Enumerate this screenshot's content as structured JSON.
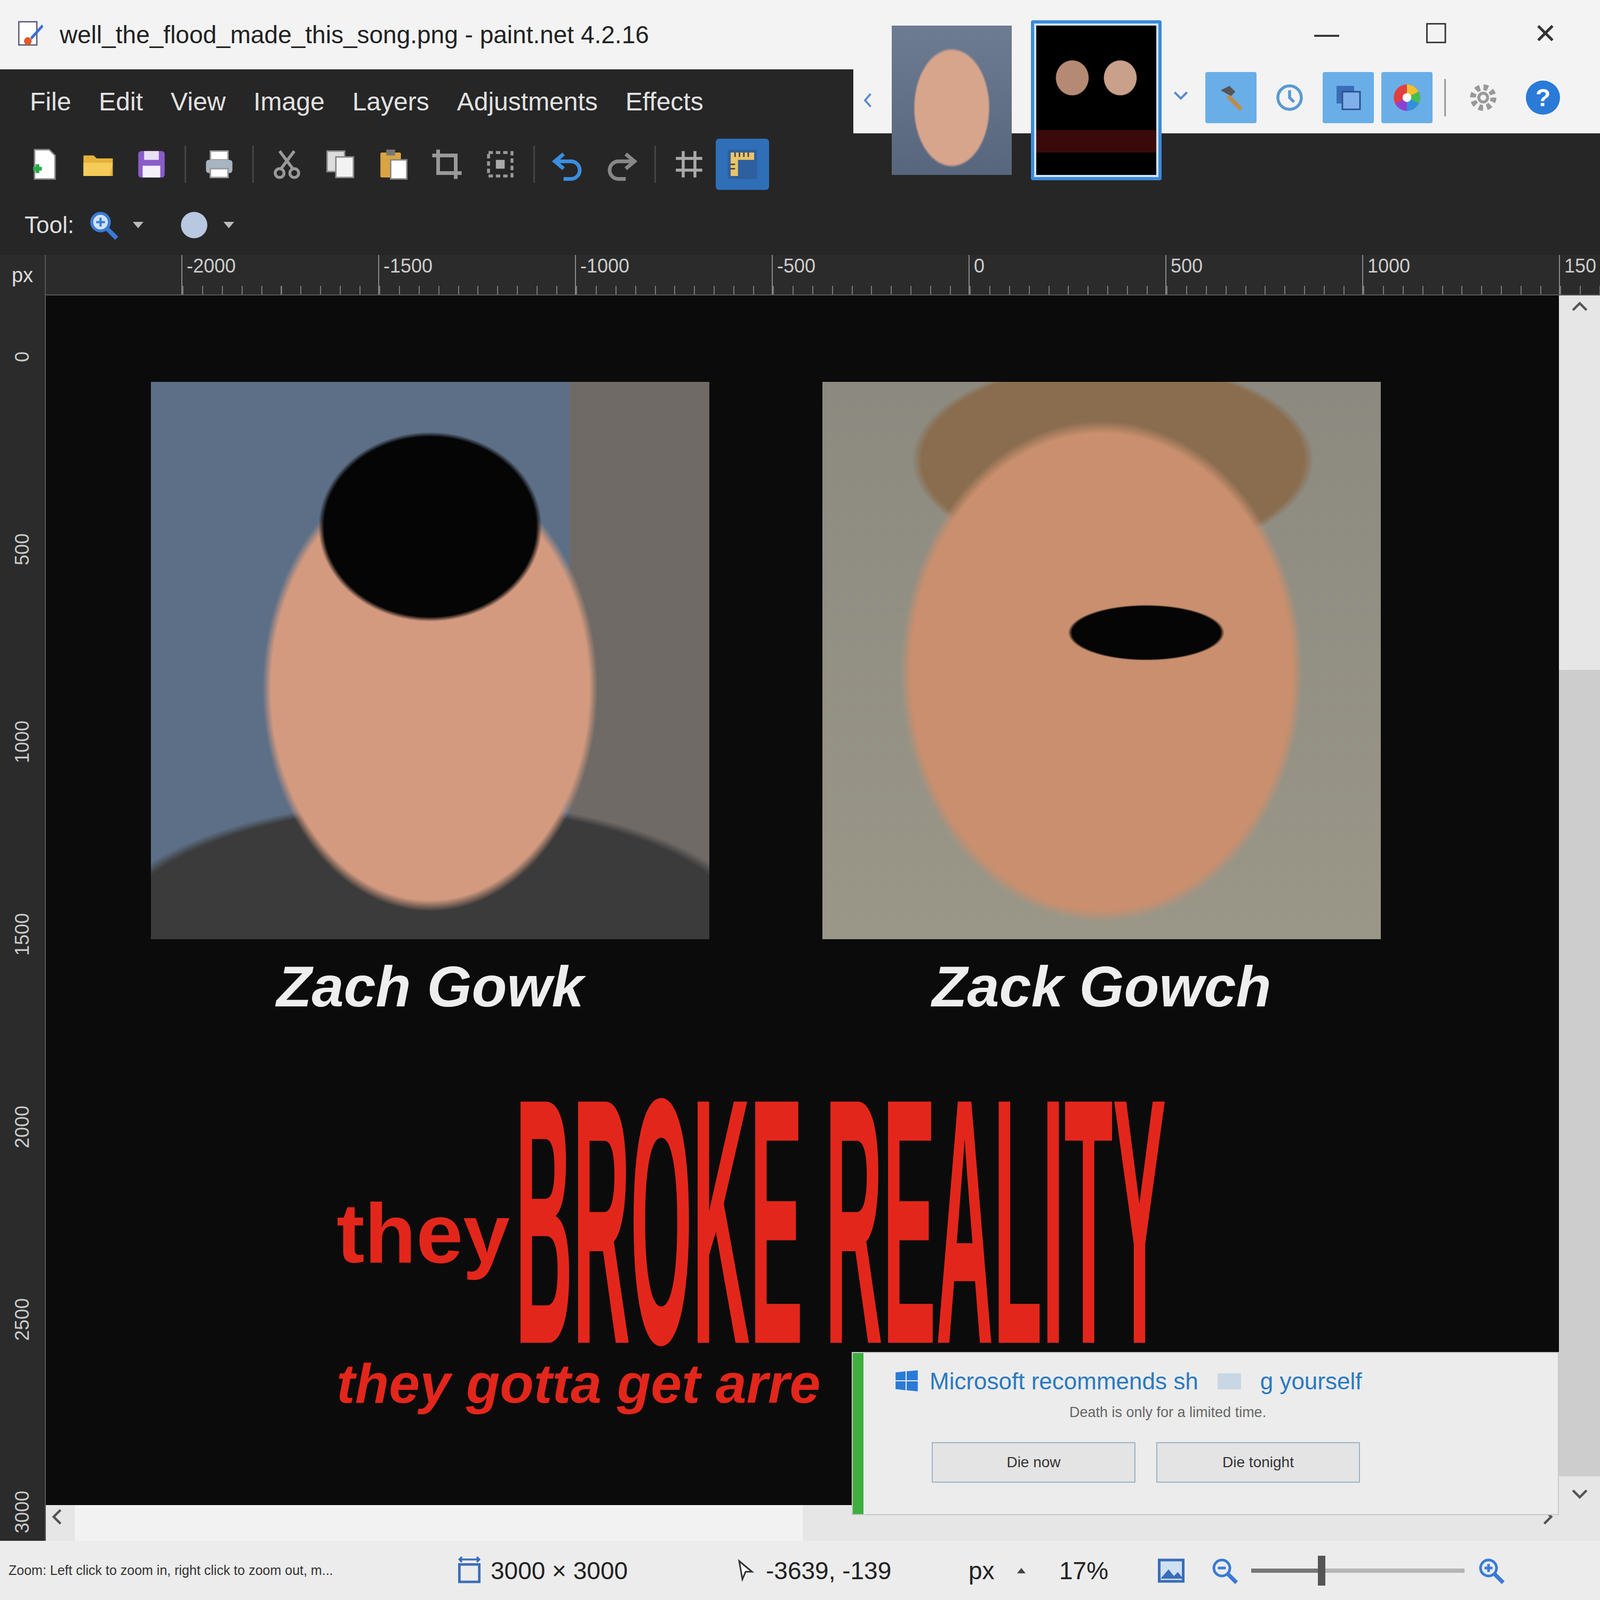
{
  "window": {
    "title": "well_the_flood_made_this_song.png - paint.net 4.2.16",
    "controls": [
      "—",
      "☐",
      "✕"
    ],
    "help": "?"
  },
  "menu": [
    "File",
    "Edit",
    "View",
    "Image",
    "Layers",
    "Adjustments",
    "Effects"
  ],
  "image_tabs": [
    {
      "selected": false
    },
    {
      "selected": true
    }
  ],
  "panel_toggles": [
    {
      "kind": "tools",
      "on": true
    },
    {
      "kind": "history",
      "on": false
    },
    {
      "kind": "layers",
      "on": true
    },
    {
      "kind": "colors",
      "on": true
    }
  ],
  "toolbar": [
    {
      "kind": "new",
      "on": false
    },
    {
      "kind": "open",
      "on": false
    },
    {
      "kind": "save",
      "on": false
    },
    {
      "kind": "print",
      "on": false
    },
    {
      "kind": "cut",
      "on": false
    },
    {
      "kind": "copy",
      "on": false
    },
    {
      "kind": "paste",
      "on": false
    },
    {
      "kind": "crop",
      "on": false
    },
    {
      "kind": "deselect",
      "on": false
    },
    {
      "kind": "undo",
      "on": false
    },
    {
      "kind": "redo",
      "on": false
    },
    {
      "kind": "grid",
      "on": false
    },
    {
      "kind": "rulers",
      "on": true
    }
  ],
  "tool_row": {
    "label": "Tool:"
  },
  "ruler": {
    "unit": "px",
    "h_labels": [
      "-2000",
      "-1500",
      "-1000",
      "-500",
      "0",
      "500",
      "1000",
      "150"
    ],
    "v_labels": [
      "0",
      "500",
      "1000",
      "1500",
      "2000",
      "2500",
      "3000"
    ]
  },
  "canvas": {
    "portraits": [
      {
        "caption": "Zach Gowk"
      },
      {
        "caption": "Zack Gowch"
      }
    ],
    "lead": "they",
    "headline": "BROKE REALITY",
    "subline": "they gotta get arre"
  },
  "notification": {
    "title_start": "Microsoft recommends sh",
    "title_end": "g yourself",
    "body": "Death is only for a limited time.",
    "buttons": [
      "Die now",
      "Die tonight"
    ]
  },
  "scrollbars": {
    "vertical": {
      "level": 0.7
    },
    "horizontal": {
      "level": 0.5
    }
  },
  "status_bar": {
    "hint": "Zoom: Left click to zoom in, right click to zoom out, m...",
    "image_size": "3000 × 3000",
    "cursor": "-3639, -139",
    "unit": "px",
    "zoom": "17%",
    "zoom_level": 0.33
  }
}
